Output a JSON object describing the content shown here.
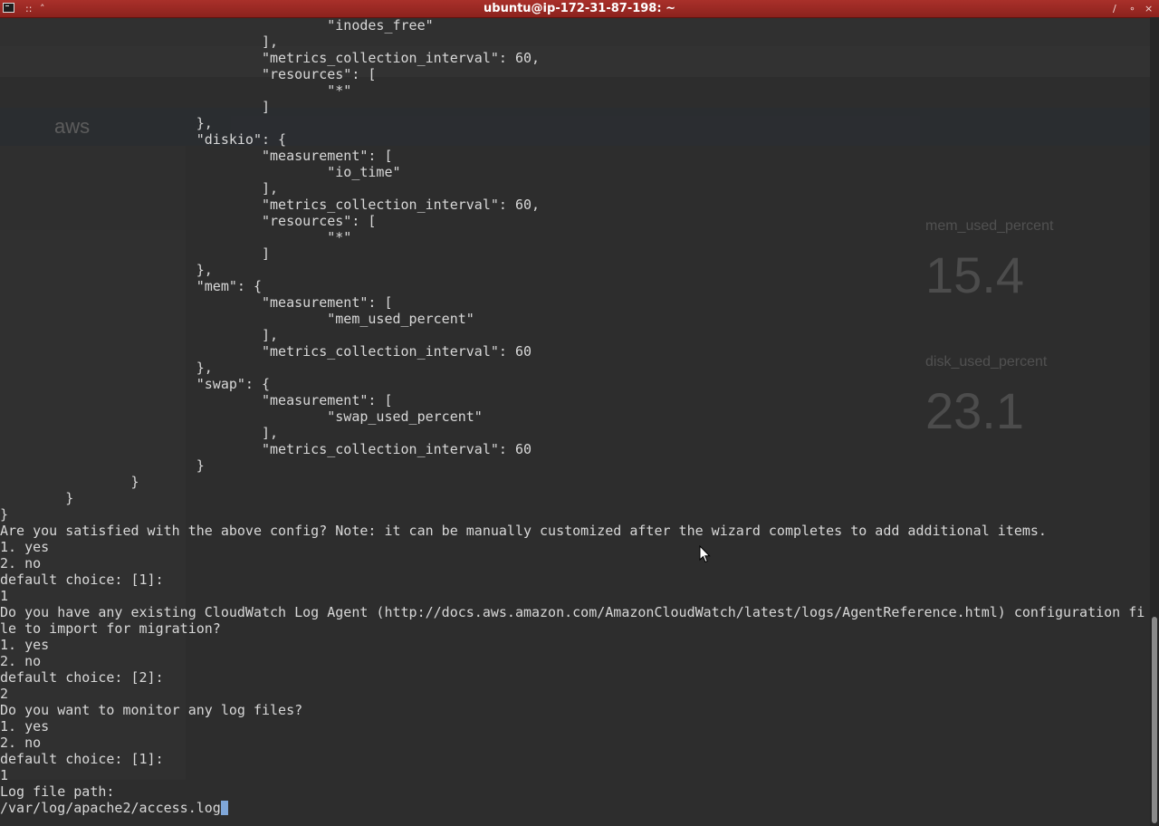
{
  "window": {
    "title": "ubuntu@ip-172-31-87-198: ~",
    "menu_glyph": "::",
    "up_glyph": "˄",
    "minimize_glyph": "∕",
    "maximize_glyph": "∘",
    "close_glyph": "×"
  },
  "ghost": {
    "aws_logo": "aws",
    "mem_label": "mem_used_percent",
    "mem_value": "15.4",
    "disk_label": "disk_used_percent",
    "disk_value": "23.1"
  },
  "terminal": {
    "lines": [
      "                                        \"inodes_free\"",
      "                                ],",
      "                                \"metrics_collection_interval\": 60,",
      "                                \"resources\": [",
      "                                        \"*\"",
      "                                ]",
      "                        },",
      "                        \"diskio\": {",
      "                                \"measurement\": [",
      "                                        \"io_time\"",
      "                                ],",
      "                                \"metrics_collection_interval\": 60,",
      "                                \"resources\": [",
      "                                        \"*\"",
      "                                ]",
      "                        },",
      "                        \"mem\": {",
      "                                \"measurement\": [",
      "                                        \"mem_used_percent\"",
      "                                ],",
      "                                \"metrics_collection_interval\": 60",
      "                        },",
      "                        \"swap\": {",
      "                                \"measurement\": [",
      "                                        \"swap_used_percent\"",
      "                                ],",
      "                                \"metrics_collection_interval\": 60",
      "                        }",
      "                }",
      "        }",
      "}",
      "Are you satisfied with the above config? Note: it can be manually customized after the wizard completes to add additional items.",
      "1. yes",
      "2. no",
      "default choice: [1]:",
      "1",
      "Do you have any existing CloudWatch Log Agent (http://docs.aws.amazon.com/AmazonCloudWatch/latest/logs/AgentReference.html) configuration fi",
      "le to import for migration?",
      "1. yes",
      "2. no",
      "default choice: [2]:",
      "2",
      "Do you want to monitor any log files?",
      "1. yes",
      "2. no",
      "default choice: [1]:",
      "1",
      "Log file path:"
    ],
    "input_value": "/var/log/apache2/access.log"
  }
}
